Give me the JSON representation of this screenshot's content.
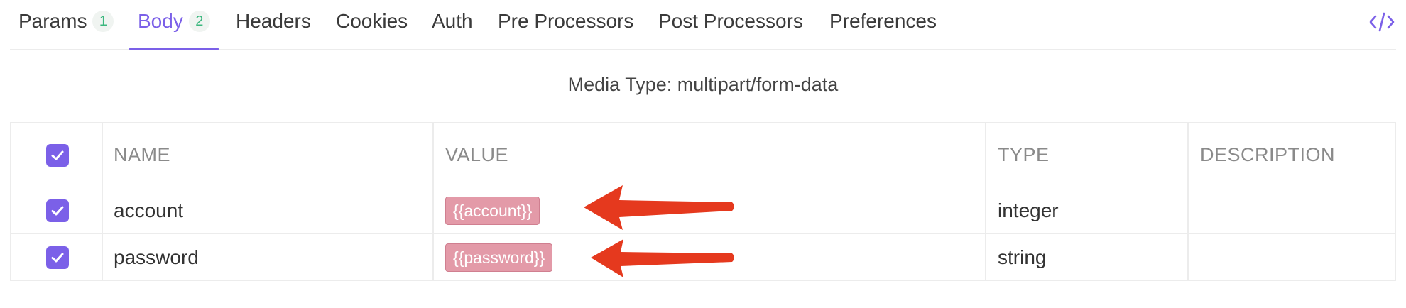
{
  "tabs": [
    {
      "label": "Params",
      "badge": "1"
    },
    {
      "label": "Body",
      "badge": "2"
    },
    {
      "label": "Headers"
    },
    {
      "label": "Cookies"
    },
    {
      "label": "Auth"
    },
    {
      "label": "Pre Processors"
    },
    {
      "label": "Post Processors"
    },
    {
      "label": "Preferences"
    }
  ],
  "active_tab": "Body",
  "code_toggle_icon": "code-icon",
  "media_type": "Media Type: multipart/form-data",
  "table": {
    "columns": [
      "NAME",
      "VALUE",
      "TYPE",
      "DESCRIPTION"
    ],
    "rows": [
      {
        "checked": true,
        "name": "account",
        "value": "{{account}}",
        "type": "integer",
        "description": ""
      },
      {
        "checked": true,
        "name": "password",
        "value": "{{password}}",
        "type": "string",
        "description": ""
      }
    ],
    "all_checked": true
  },
  "annotations": {
    "arrow_color": "#e5391e"
  },
  "colors": {
    "accent": "#7b60e8",
    "badge_text": "#3bb77e",
    "variable_tag": "#e39aa8"
  }
}
